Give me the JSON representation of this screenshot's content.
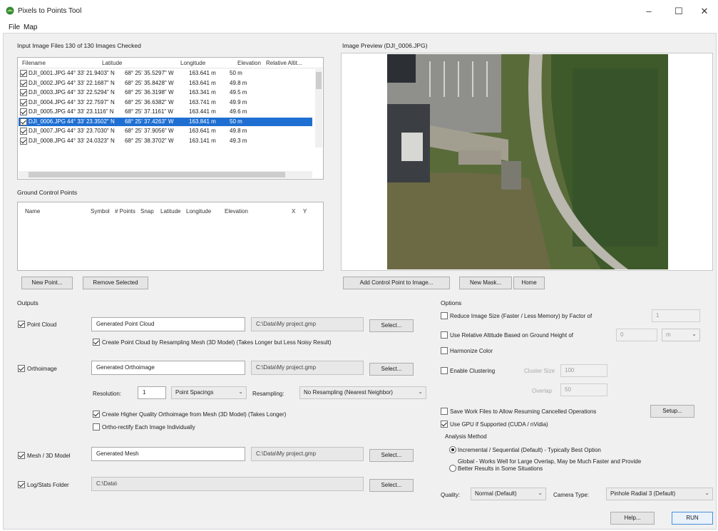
{
  "window": {
    "title": "Pixels to Points Tool",
    "minimize": "–",
    "maximize": "☐",
    "close": "✕"
  },
  "menu": [
    "File",
    "Map"
  ],
  "input_files": {
    "label": "Input Image Files 130 of 130 Images Checked",
    "columns": [
      "Filename",
      "Latitude",
      "Longitude",
      "Elevation",
      "Relative Altit..."
    ],
    "rows": [
      {
        "file": "DJI_0001.JPG",
        "lat": "44° 33' 21.9403\" N",
        "lon": "68° 25' 35.5297\" W",
        "elev": "163.641 m",
        "rel": "50 m"
      },
      {
        "file": "DJI_0002.JPG",
        "lat": "44° 33' 22.1687\" N",
        "lon": "68° 25' 35.8428\" W",
        "elev": "163.641 m",
        "rel": "49.8 m"
      },
      {
        "file": "DJI_0003.JPG",
        "lat": "44° 33' 22.5294\" N",
        "lon": "68° 25' 36.3198\" W",
        "elev": "163.341 m",
        "rel": "49.5 m"
      },
      {
        "file": "DJI_0004.JPG",
        "lat": "44° 33' 22.7597\" N",
        "lon": "68° 25' 36.6382\" W",
        "elev": "163.741 m",
        "rel": "49.9 m"
      },
      {
        "file": "DJI_0005.JPG",
        "lat": "44° 33' 23.1116\" N",
        "lon": "68° 25' 37.1161\" W",
        "elev": "163.441 m",
        "rel": "49.6 m"
      },
      {
        "file": "DJI_0006.JPG",
        "lat": "44° 33' 23.3502\" N",
        "lon": "68° 25' 37.4263\" W",
        "elev": "163.841 m",
        "rel": "50 m"
      },
      {
        "file": "DJI_0007.JPG",
        "lat": "44° 33' 23.7030\" N",
        "lon": "68° 25' 37.9056\" W",
        "elev": "163.641 m",
        "rel": "49.8 m"
      },
      {
        "file": "DJI_0008.JPG",
        "lat": "44° 33' 24.0323\" N",
        "lon": "68° 25' 38.3702\" W",
        "elev": "163.141 m",
        "rel": "49.3 m"
      }
    ],
    "selected_index": 5
  },
  "gcp": {
    "label": "Ground Control Points",
    "columns": [
      "Name",
      "Symbol",
      "# Points",
      "Snap",
      "Latitude",
      "Longitude",
      "Elevation",
      "X",
      "Y"
    ],
    "new_point": "New Point...",
    "remove_selected": "Remove Selected"
  },
  "preview": {
    "label": "Image Preview (DJI_0006.JPG)",
    "add_control_point": "Add Control Point to Image...",
    "new_mask": "New Mask...",
    "home": "Home"
  },
  "outputs": {
    "label": "Outputs",
    "point_cloud": {
      "label": "Point Cloud",
      "name": "Generated Point Cloud",
      "path": "C:\\Data\\My project.gmp",
      "select": "Select...",
      "resample_label": "Create Point Cloud by Resampling Mesh (3D Model) (Takes Longer but Less Noisy Result)"
    },
    "orthoimage": {
      "label": "Orthoimage",
      "name": "Generated Orthoimage",
      "path": "C:\\Data\\My project.gmp",
      "select": "Select...",
      "resolution_label": "Resolution:",
      "resolution_value": "1",
      "spacing": "Point Spacings",
      "resampling_label": "Resampling:",
      "resampling_value": "No Resampling (Nearest Neighbor)",
      "hq_label": "Create Higher Quality Orthoimage from Mesh (3D Model) (Takes Longer)",
      "ortho_each_label": "Ortho-rectify Each Image Individually"
    },
    "mesh": {
      "label": "Mesh / 3D Model",
      "name": "Generated Mesh",
      "path": "C:\\Data\\My project.gmp",
      "select": "Select..."
    },
    "log": {
      "label": "Log/Stats Folder",
      "path": "C:\\Data\\",
      "select": "Select..."
    }
  },
  "options": {
    "label": "Options",
    "reduce_size": "Reduce Image Size (Faster / Less Memory) by Factor of",
    "reduce_value": "1",
    "relative_alt": "Use Relative Altitude Based on Ground Height of",
    "relative_value": "0",
    "relative_unit": "m",
    "harmonize": "Harmonize Color",
    "clustering": "Enable Clustering",
    "cluster_size_label": "Cluster Size",
    "cluster_size_value": "100",
    "cluster_overlap_label": "Overlap",
    "cluster_overlap_value": "50",
    "save_work": "Save Work Files to Allow Resuming Cancelled Operations",
    "setup": "Setup...",
    "use_gpu": "Use GPU if Supported (CUDA / nVidia)",
    "analysis_method": "Analysis Method",
    "incremental": "Incremental / Sequential (Default) - Typically Best Option",
    "global_line1": "Global - Works Well for Large Overlap, May be Much Faster and Provide",
    "global_line2": "Better Results in Some Situations",
    "quality_label": "Quality:",
    "quality_value": "Normal (Default)",
    "camera_label": "Camera Type:",
    "camera_value": "Pinhole Radial 3 (Default)"
  },
  "footer": {
    "help": "Help...",
    "run": "RUN"
  }
}
